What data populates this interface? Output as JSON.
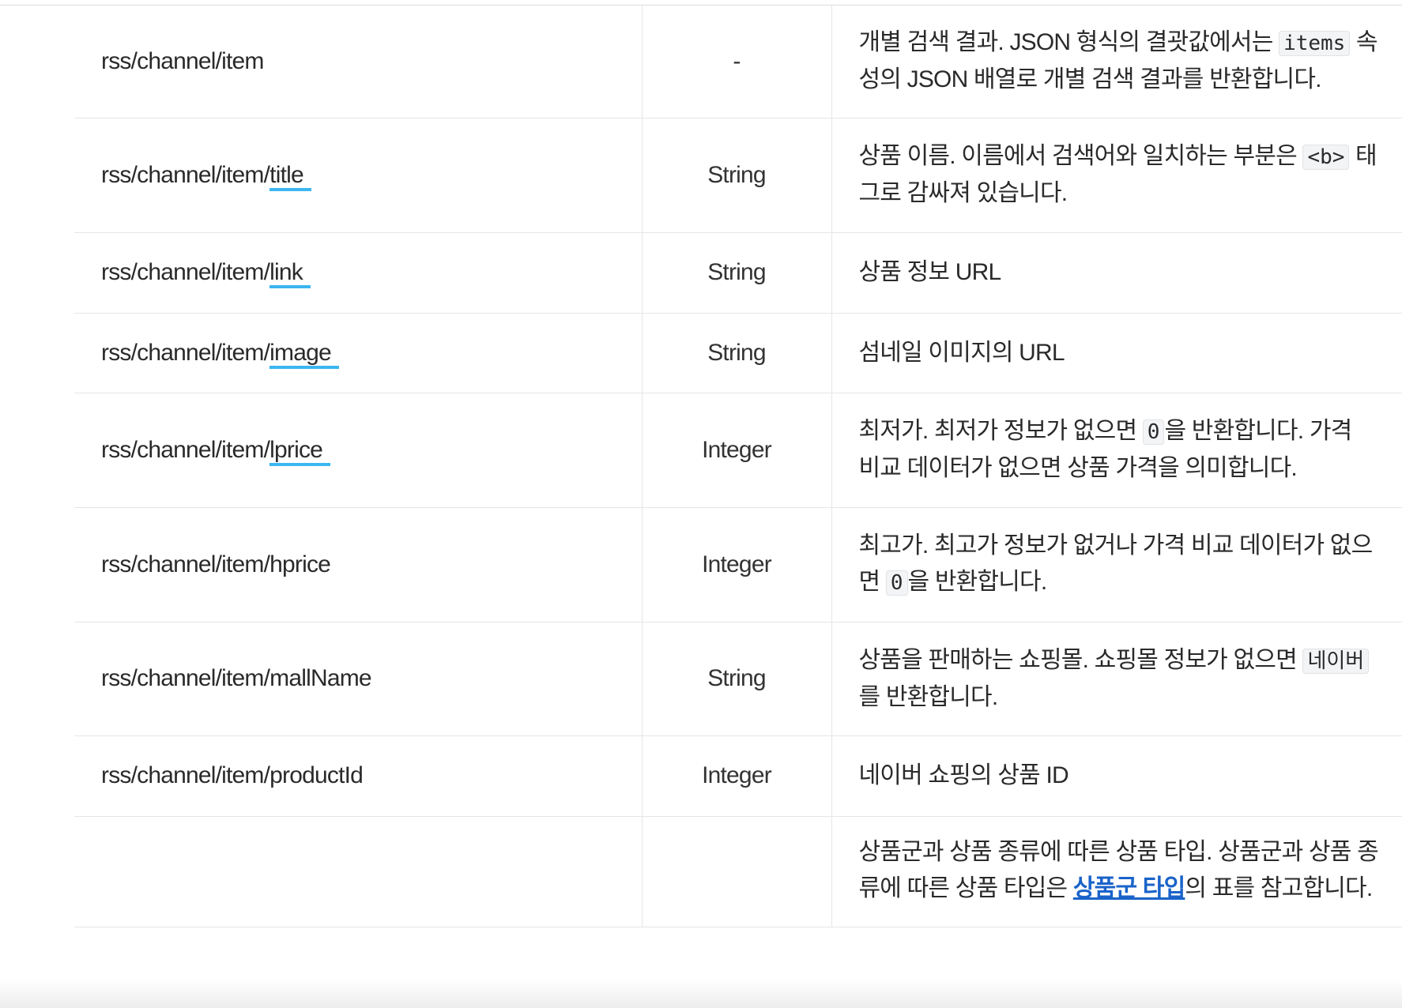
{
  "rows": [
    {
      "field": "rss/channel/item",
      "field_prefix": "",
      "field_suffix": "",
      "type": "-",
      "desc_1": "개별 검색 결과. JSON 형식의 결괏값에서는 ",
      "desc_code": "items",
      "desc_2": " 속성의 JSON 배열로 개별 검색 결과를 반환합니다."
    },
    {
      "field_prefix": "rss/channel/item/",
      "field_suffix": "title",
      "type": "String",
      "desc_1": "상품 이름. 이름에서 검색어와 일치하는 부분은 ",
      "desc_code": "<b>",
      "desc_2": " 태그로 감싸져 있습니다."
    },
    {
      "field_prefix": "rss/channel/item/",
      "field_suffix": "link",
      "type": "String",
      "desc_1": "상품 정보 URL"
    },
    {
      "field_prefix": "rss/channel/item/",
      "field_suffix": "image",
      "type": "String",
      "desc_1": "섬네일 이미지의 URL"
    },
    {
      "field_prefix": "rss/channel/item/",
      "field_suffix": "lprice",
      "type": "Integer",
      "desc_1": "최저가. 최저가 정보가 없으면 ",
      "desc_code": "0",
      "desc_2": "을 반환합니다. 가격 비교 데이터가 없으면 상품 가격을 의미합니다."
    },
    {
      "field": "rss/channel/item/hprice",
      "type": "Integer",
      "desc_1": "최고가. 최고가 정보가 없거나 가격 비교 데이터가 없으면 ",
      "desc_code": "0",
      "desc_2": "을 반환합니다."
    },
    {
      "field": "rss/channel/item/mallName",
      "type": "String",
      "desc_1": "상품을 판매하는 쇼핑몰. 쇼핑몰 정보가 없으면 ",
      "desc_code": "네이버",
      "desc_2": "를 반환합니다."
    },
    {
      "field": "rss/channel/item/productId",
      "type": "Integer",
      "desc_1": "네이버 쇼핑의 상품 ID"
    },
    {
      "field": "",
      "type": "",
      "desc_1": "상품군과 상품 종류에 따른 상품 타입. 상품군과 상품 종류에 따른 상품 타입은 ",
      "desc_link": "상품군 타입",
      "desc_2": "의 표를 참고합니다."
    }
  ],
  "colors": {
    "highlight_underline": "#3bb6f0",
    "link": "#1a63c9",
    "border": "#e6e6e6"
  }
}
